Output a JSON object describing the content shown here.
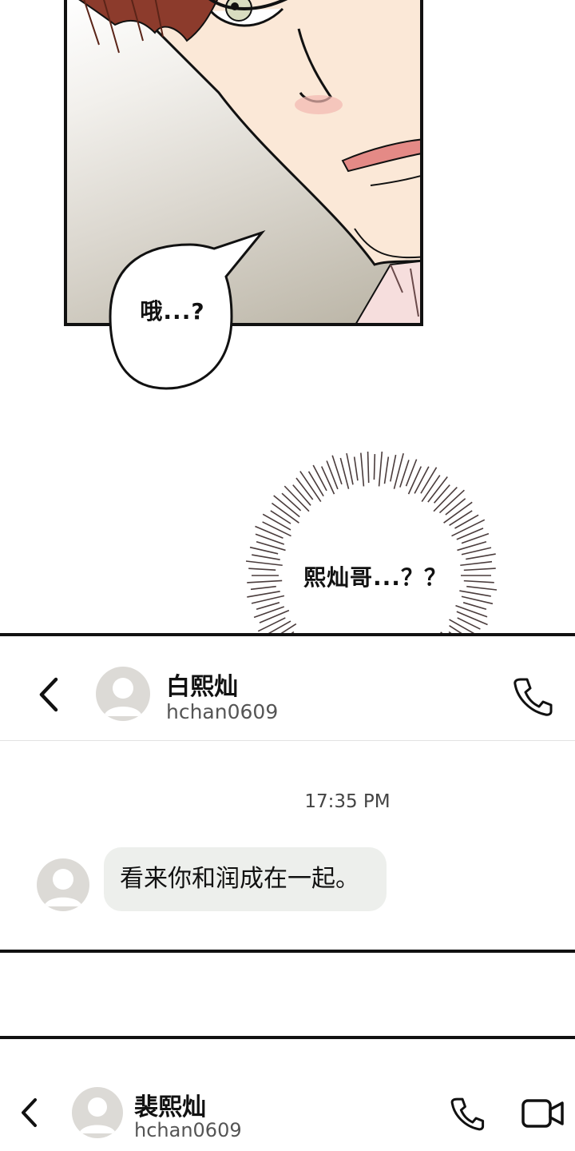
{
  "comic": {
    "speech_text": "哦...?",
    "thought_text": "熙灿哥...？？"
  },
  "chat": {
    "contact_name": "白熙灿",
    "contact_id": "hchan0609",
    "timestamp": "17:35 PM",
    "messages": [
      {
        "text": "看来你和润成在一起。"
      }
    ],
    "icons": {
      "back": "chevron-left-icon",
      "call": "phone-icon",
      "avatar": "default-avatar-icon"
    }
  },
  "bottom_bar": {
    "contact_name": "裴熙灿",
    "contact_id": "hchan0609",
    "icons": {
      "back": "chevron-left-icon",
      "call": "phone-icon",
      "video": "video-camera-icon"
    }
  },
  "colors": {
    "bubble_bg": "#edefec",
    "avatar_bg": "#dcdad6",
    "hair": "#8c3b2c",
    "skin": "#fbe8d7"
  }
}
